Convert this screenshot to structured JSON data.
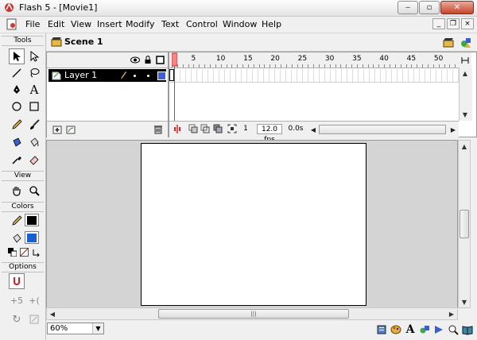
{
  "window": {
    "title": "Flash 5 - [Movie1]"
  },
  "menu": [
    {
      "label": "File"
    },
    {
      "label": "Edit"
    },
    {
      "label": "View"
    },
    {
      "label": "Insert"
    },
    {
      "label": "Modify"
    },
    {
      "label": "Text"
    },
    {
      "label": "Control"
    },
    {
      "label": "Window"
    },
    {
      "label": "Help"
    }
  ],
  "tools": {
    "header": "Tools",
    "view_header": "View",
    "colors_header": "Colors",
    "options_header": "Options",
    "stroke_color": "#000000",
    "fill_color": "#1a5fcf"
  },
  "scene": {
    "name": "Scene 1"
  },
  "timeline": {
    "layer_name": "Layer 1",
    "frame_numbers": [
      "5",
      "10",
      "15",
      "20",
      "25",
      "30",
      "35",
      "40",
      "45",
      "50"
    ],
    "current_frame": "1",
    "fps": "12.0 fps",
    "elapsed": "0.0s"
  },
  "statusbar": {
    "zoom": "60%"
  },
  "colors": {
    "playhead": "#e03030",
    "layer_color": "#3f5fe0",
    "selection": "#000000"
  }
}
